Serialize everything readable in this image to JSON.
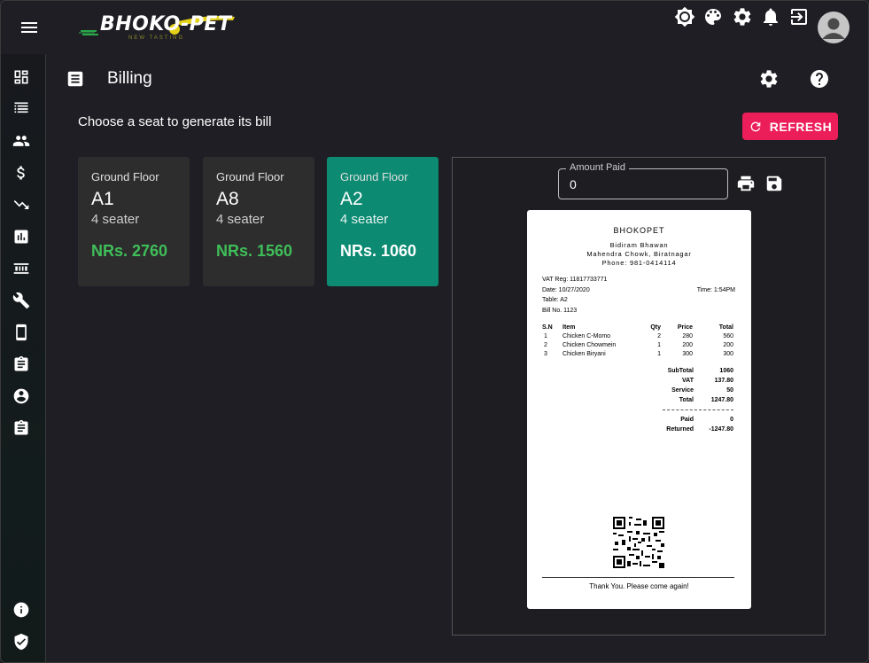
{
  "app": {
    "logo_text": "BHOKO-PET",
    "logo_tagline": "NEW TASTING"
  },
  "colors": {
    "accent": "#ec1e5a",
    "active_card": "#0c8a72",
    "amount_green": "#3fbf5a",
    "background": "#1f1e24"
  },
  "topbar": {
    "icons": [
      "menu-icon",
      "brightness-icon",
      "palette-icon",
      "settings-icon",
      "notifications-icon",
      "logout-icon",
      "account-icon"
    ]
  },
  "sidebar": {
    "top_icons": [
      "dashboard-icon",
      "list-icon",
      "people-icon",
      "dollar-icon",
      "trending-down-icon",
      "bar-chart-icon",
      "seats-icon",
      "wrench-icon",
      "phone-icon",
      "clipboard-icon",
      "account-circle-icon",
      "assignment-icon"
    ],
    "bottom_icons": [
      "info-icon",
      "shield-icon"
    ]
  },
  "page": {
    "title": "Billing",
    "instruction": "Choose a seat to generate its bill",
    "refresh_label": "REFRESH"
  },
  "seats": [
    {
      "floor": "Ground Floor",
      "name": "A1",
      "capacity": "4 seater",
      "amount": "NRs. 2760",
      "active": false
    },
    {
      "floor": "Ground Floor",
      "name": "A8",
      "capacity": "4 seater",
      "amount": "NRs. 1560",
      "active": false
    },
    {
      "floor": "Ground Floor",
      "name": "A2",
      "capacity": "4 seater",
      "amount": "NRs. 1060",
      "active": true
    }
  ],
  "bill": {
    "amount_label": "Amount Paid",
    "amount_value": "0"
  },
  "receipt": {
    "title": "BHOKOPET",
    "address1": "Bidiram Bhawan",
    "address2": "Mahendra Chowk, Biratnagar",
    "phone": "Phone: 981-0414114",
    "vat": "VAT Reg: 11817733771",
    "date": "Date: 10/27/2020",
    "time": "Time: 1:54PM",
    "table": "Table: A2",
    "bill_no": "Bill No. 1123",
    "columns": [
      "S.N",
      "Item",
      "Qty",
      "Price",
      "Total"
    ],
    "items": [
      {
        "sn": "1",
        "item": "Chicken C-Momo",
        "qty": "2",
        "price": "280",
        "total": "560"
      },
      {
        "sn": "2",
        "item": "Chicken Chowmein",
        "qty": "1",
        "price": "200",
        "total": "200"
      },
      {
        "sn": "3",
        "item": "Chicken Biryani",
        "qty": "1",
        "price": "300",
        "total": "300"
      }
    ],
    "subtotal_label": "SubTotal",
    "subtotal": "1060",
    "vat_label": "VAT",
    "vat_value": "137.80",
    "service_label": "Service",
    "service": "50",
    "total_label": "Total",
    "total": "1247.80",
    "paid_label": "Paid",
    "paid": "0",
    "returned_label": "Returned",
    "returned": "-1247.80",
    "thanks": "Thank You. Please come again!"
  }
}
